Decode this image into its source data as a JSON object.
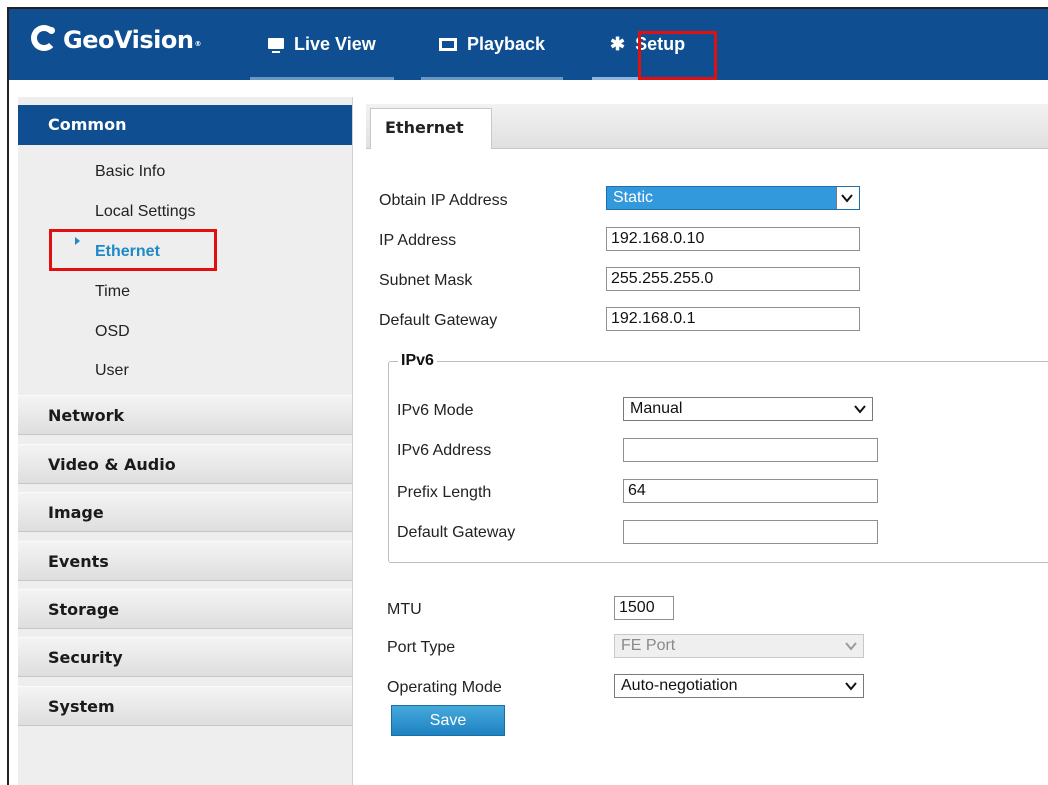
{
  "app": {
    "logo_text": "GeoVision",
    "nav": [
      {
        "label": "Live View",
        "icon": "monitor-icon"
      },
      {
        "label": "Playback",
        "icon": "film-icon"
      },
      {
        "label": "Setup",
        "icon": "gear-icon"
      }
    ],
    "active_nav": "Setup"
  },
  "sidebar": {
    "active_section": {
      "label": "Common",
      "items": [
        "Basic Info",
        "Local Settings",
        "Ethernet",
        "Time",
        "OSD",
        "User"
      ],
      "selected": "Ethernet"
    },
    "sections": [
      "Network",
      "Video & Audio",
      "Image",
      "Events",
      "Storage",
      "Security",
      "System"
    ]
  },
  "content": {
    "tab": "Ethernet",
    "fields": {
      "obtain_ip": {
        "label": "Obtain IP Address",
        "value": "Static"
      },
      "ip_address": {
        "label": "IP Address",
        "value": "192.168.0.10"
      },
      "subnet_mask": {
        "label": "Subnet Mask",
        "value": "255.255.255.0"
      },
      "default_gateway": {
        "label": "Default Gateway",
        "value": "192.168.0.1"
      }
    },
    "ipv6": {
      "legend": "IPv6",
      "mode": {
        "label": "IPv6 Mode",
        "value": "Manual"
      },
      "address": {
        "label": "IPv6 Address",
        "value": ""
      },
      "prefix": {
        "label": "Prefix Length",
        "value": "64"
      },
      "gateway": {
        "label": "Default Gateway",
        "value": ""
      }
    },
    "mtu": {
      "label": "MTU",
      "value": "1500"
    },
    "port_type": {
      "label": "Port Type",
      "value": "FE Port"
    },
    "operating_mode": {
      "label": "Operating Mode",
      "value": "Auto-negotiation"
    },
    "save_label": "Save"
  },
  "colors": {
    "header_blue": "#0e4e91",
    "highlight_red": "#e01010",
    "selected_blue": "#1f88c7",
    "save_button": "#1f82c2"
  }
}
